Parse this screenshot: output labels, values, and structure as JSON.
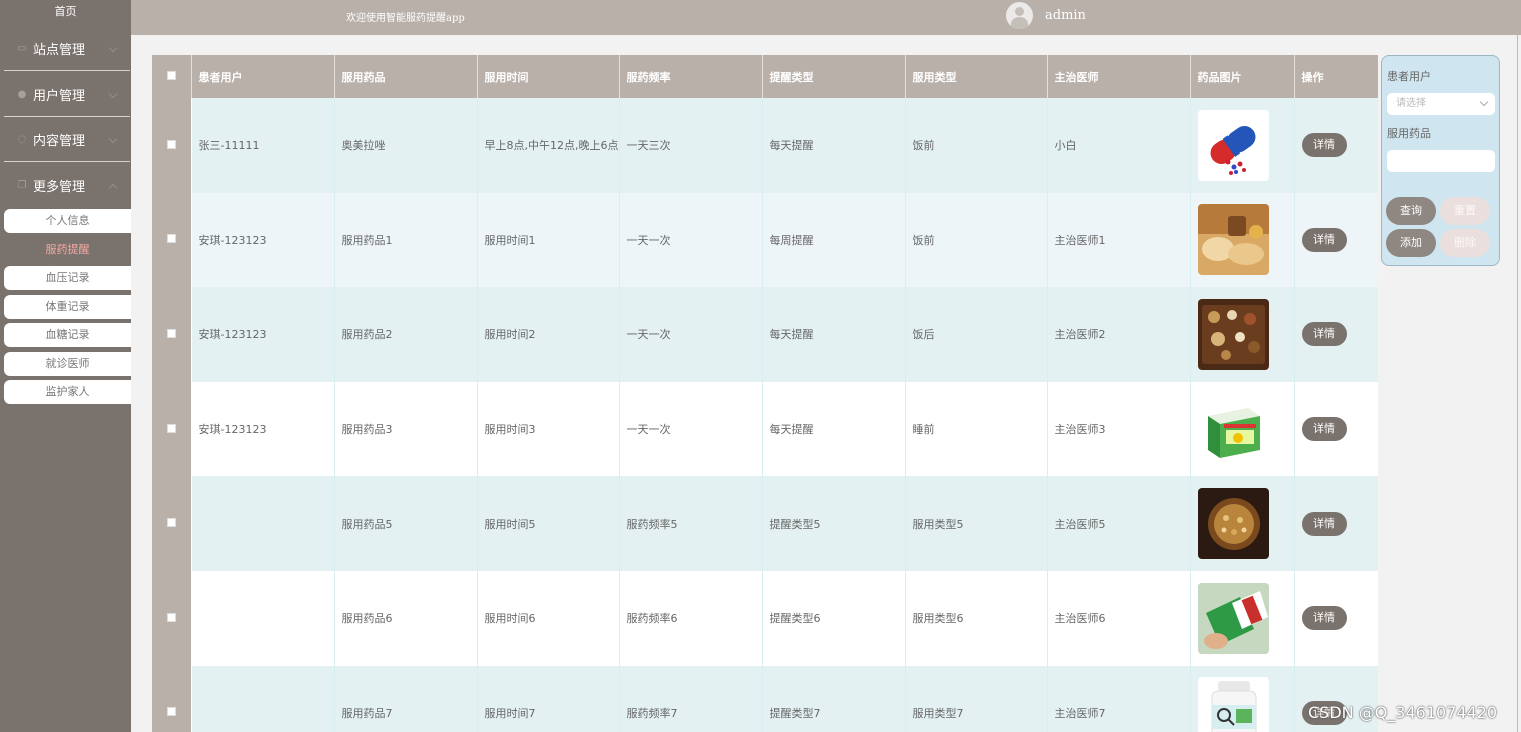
{
  "sidebar": {
    "home": "首页",
    "groups": [
      {
        "label": "站点管理",
        "icon": "message-icon"
      },
      {
        "label": "用户管理",
        "icon": "user-icon"
      },
      {
        "label": "内容管理",
        "icon": "chat-icon"
      },
      {
        "label": "更多管理",
        "icon": "copy-icon"
      }
    ],
    "subitems": [
      "个人信息",
      "服药提醒",
      "血压记录",
      "体重记录",
      "血糖记录",
      "就诊医师",
      "监护家人"
    ],
    "active_subitem": "服药提醒"
  },
  "header": {
    "welcome": "欢迎使用智能服药提醒app",
    "username": "admin"
  },
  "table": {
    "headers": [
      "患者用户",
      "服用药品",
      "服用时间",
      "服药频率",
      "提醒类型",
      "服用类型",
      "主治医师",
      "药品图片",
      "操作"
    ],
    "detail_label": "详情",
    "rows": [
      {
        "patient": "张三-11111",
        "drug": "奥美拉唑",
        "time": "早上8点,中午12点,晚上6点",
        "freq": "一天三次",
        "remind": "每天提醒",
        "type": "饭前",
        "doctor": "小白",
        "image": "capsule-pills"
      },
      {
        "patient": "安琪-123123",
        "drug": "服用药品1",
        "time": "服用时间1",
        "freq": "一天一次",
        "remind": "每周提醒",
        "type": "饭前",
        "doctor": "主治医师1",
        "image": "herbal-bread"
      },
      {
        "patient": "安琪-123123",
        "drug": "服用药品2",
        "time": "服用时间2",
        "freq": "一天一次",
        "remind": "每天提醒",
        "type": "饭后",
        "doctor": "主治医师2",
        "image": "herbs-tray"
      },
      {
        "patient": "安琪-123123",
        "drug": "服用药品3",
        "time": "服用时间3",
        "freq": "一天一次",
        "remind": "每天提醒",
        "type": "睡前",
        "doctor": "主治医师3",
        "image": "medicine-box"
      },
      {
        "patient": "",
        "drug": "服用药品5",
        "time": "服用时间5",
        "freq": "服药频率5",
        "remind": "提醒类型5",
        "type": "服用类型5",
        "doctor": "主治医师5",
        "image": "herbal-bowl"
      },
      {
        "patient": "",
        "drug": "服用药品6",
        "time": "服用时间6",
        "freq": "服药频率6",
        "remind": "提醒类型6",
        "type": "服用类型6",
        "doctor": "主治医师6",
        "image": "green-packet"
      },
      {
        "patient": "",
        "drug": "服用药品7",
        "time": "服用时间7",
        "freq": "服药频率7",
        "remind": "提醒类型7",
        "type": "服用类型7",
        "doctor": "主治医师7",
        "image": "pill-bottle"
      }
    ]
  },
  "search": {
    "patient_label": "患者用户",
    "patient_placeholder": "请选择",
    "drug_label": "服用药品",
    "drug_value": "",
    "query_button": "查询",
    "reset_button": "重置",
    "add_button": "添加",
    "delete_button": "删除"
  },
  "watermark": "CSDN @Q_3461074420",
  "colors": {
    "sidebar": "#7a726d",
    "header": "#b9b0aa",
    "row_tint": "#e4f1f3",
    "panel": "#cfe6f0",
    "active_text": "#f3a9a3"
  }
}
